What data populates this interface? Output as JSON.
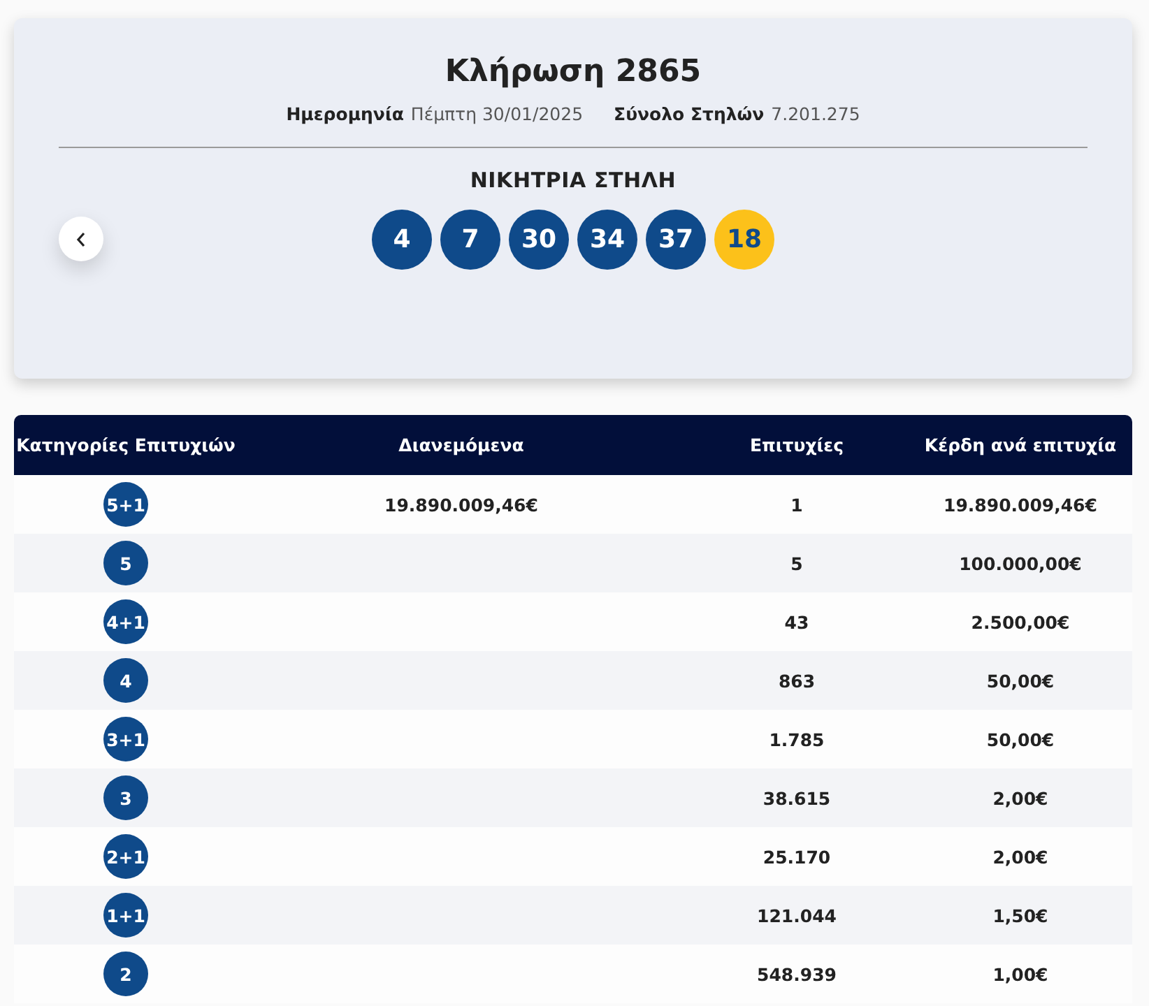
{
  "draw": {
    "title": "Κλήρωση 2865",
    "date_label": "Ημερομηνία",
    "date_value": "Πέμπτη 30/01/2025",
    "total_label": "Σύνολο Στηλών",
    "total_value": "7.201.275"
  },
  "winning_column": {
    "heading": "ΝΙΚΗΤΡΙΑ ΣΤΗΛΗ",
    "balls": [
      {
        "number": "4",
        "kind": "main"
      },
      {
        "number": "7",
        "kind": "main"
      },
      {
        "number": "30",
        "kind": "main"
      },
      {
        "number": "34",
        "kind": "main"
      },
      {
        "number": "37",
        "kind": "main"
      },
      {
        "number": "18",
        "kind": "bonus"
      }
    ]
  },
  "table": {
    "columns": [
      "Κατηγορίες Επιτυχιών",
      "Διανεμόμενα",
      "Επιτυχίες",
      "Κέρδη ανά επιτυχία"
    ],
    "rows": [
      {
        "category": "5+1",
        "distributed": "19.890.009,46€",
        "winners": "1",
        "prize": "19.890.009,46€"
      },
      {
        "category": "5",
        "winners": "5",
        "prize": "100.000,00€"
      },
      {
        "category": "4+1",
        "winners": "43",
        "prize": "2.500,00€"
      },
      {
        "category": "4",
        "winners": "863",
        "prize": "50,00€"
      },
      {
        "category": "3+1",
        "winners": "1.785",
        "prize": "50,00€"
      },
      {
        "category": "3",
        "winners": "38.615",
        "prize": "2,00€"
      },
      {
        "category": "2+1",
        "winners": "25.170",
        "prize": "2,00€"
      },
      {
        "category": "1+1",
        "winners": "121.044",
        "prize": "1,50€"
      },
      {
        "category": "2",
        "winners": "548.939",
        "prize": "1,00€"
      }
    ]
  }
}
